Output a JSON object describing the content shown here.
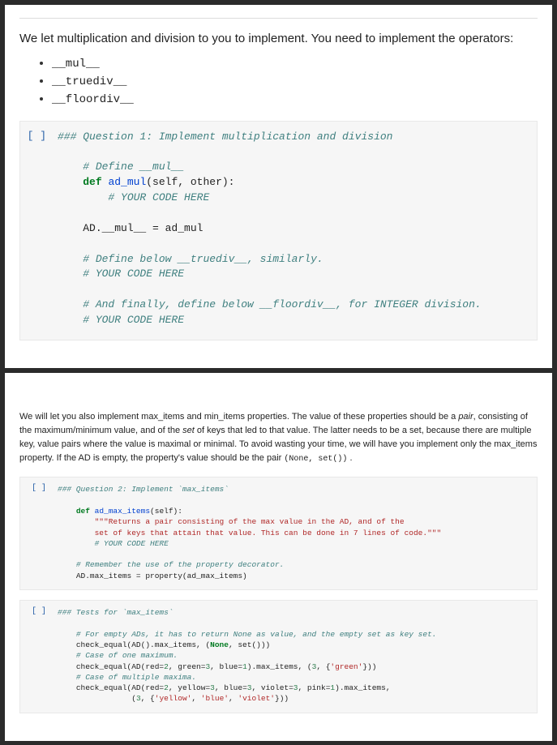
{
  "page1": {
    "intro_lead": "We let multiplication and division to you to implement. You need to implement the operators:",
    "bullets": [
      "__mul__",
      "__truediv__",
      "__floordiv__"
    ],
    "gutter": "[ ]",
    "q1_title": "### Question 1: Implement multiplication and division",
    "c_define_mul": "# Define __mul__",
    "c_def_kw": "def",
    "c_def_name": "ad_mul",
    "c_def_args": "(self, other):",
    "c_your_code": "# YOUR CODE HERE",
    "c_assign": "AD.__mul__ = ad_mul",
    "c_define_truediv": "# Define below __truediv__, similarly.",
    "c_define_floordiv": "# And finally, define below __floordiv__, for INTEGER division."
  },
  "page2": {
    "intro_p1a": "We will let you also implement max_items and min_items properties. The value of these properties should be a ",
    "intro_p1_pair": "pair",
    "intro_p1b": ", consisting of the maximum/minimum value, and of the ",
    "intro_p1_set": "set",
    "intro_p1c": " of keys that led to that value. The latter needs to be a set, because there are multiple key, value pairs where the value is maximal or minimal. To avoid wasting your time, we will have you implement only the max_items property. If the AD is empty, the property's value should be the pair ",
    "intro_pair_code": "(None, set())",
    "intro_p1d": " .",
    "gutter": "[ ]",
    "q2_title": "### Question 2: Implement `max_items`",
    "q2_def_kw": "def",
    "q2_def_name": "ad_max_items",
    "q2_def_args": "(self):",
    "q2_doc1": "\"\"\"Returns a pair consisting of the max value in the AD, and of the",
    "q2_doc2": "set of keys that attain that value. This can be done in 7 lines of code.\"\"\"",
    "q2_your_code": "# YOUR CODE HERE",
    "q2_remember": "# Remember the use of the property decorator.",
    "q2_assign": "AD.max_items = property(ad_max_items)",
    "t_title": "### Tests for `max_items`",
    "t_c1": "# For empty ADs, it has to return None as value, and the empty set as key set.",
    "t_l1": "check_equal(AD().max_items, (None, set()))",
    "t_c2": "# Case of one maximum.",
    "t_l2": "check_equal(AD(red=2, green=3, blue=1).max_items, (3, {'green'}))",
    "t_c3": "# Case of multiple maxima.",
    "t_l3a": "check_equal(AD(red=2, yellow=3, blue=3, violet=3, pink=1).max_items,",
    "t_l3b": "            (3, {'yellow', 'blue', 'violet'}))"
  }
}
